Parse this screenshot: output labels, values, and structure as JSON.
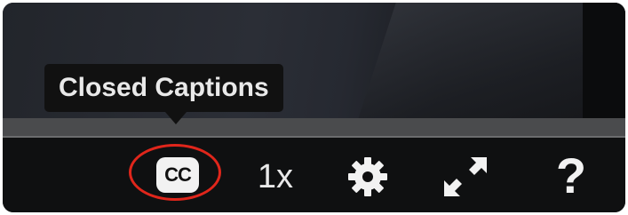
{
  "tooltip": {
    "text": "Closed Captions"
  },
  "controls": {
    "cc_label": "CC",
    "speed_label": "1x",
    "settings_icon": "gear-icon",
    "fullscreen_icon": "expand-arrows-icon",
    "help_label": "?"
  },
  "colors": {
    "control_bar": "#0f1011",
    "progress_track": "#4a4b4d",
    "highlight_ring": "#e0261b",
    "icon": "#f2f2f2"
  }
}
